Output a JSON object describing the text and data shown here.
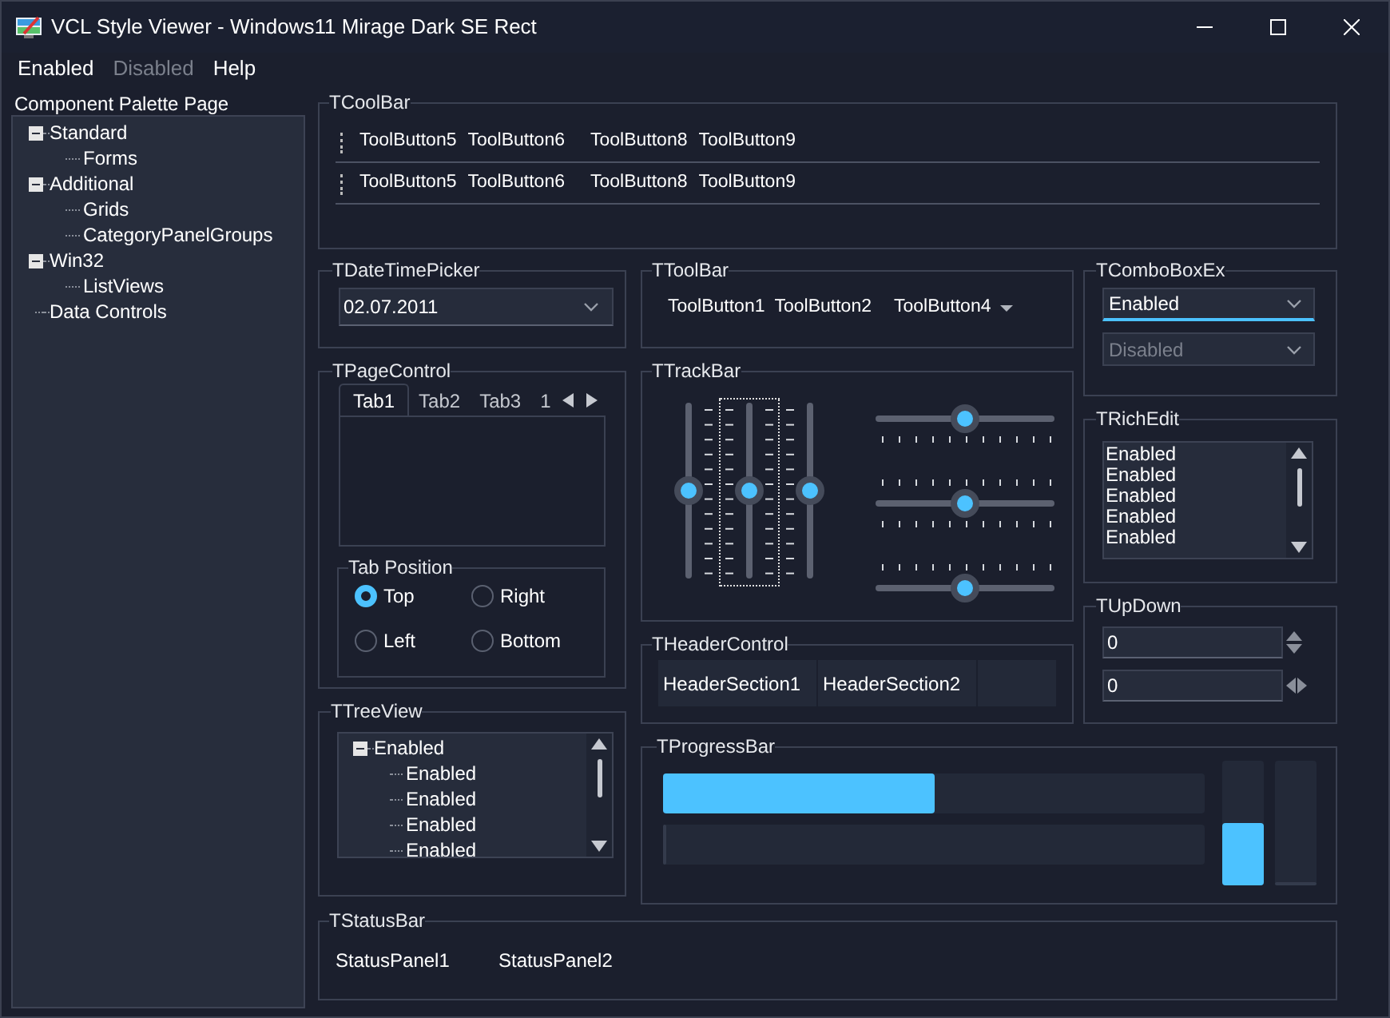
{
  "window": {
    "title": "VCL Style Viewer - Windows11 Mirage Dark SE Rect"
  },
  "menu": [
    {
      "label": "Enabled",
      "disabled": false
    },
    {
      "label": "Disabled",
      "disabled": true
    },
    {
      "label": "Help",
      "disabled": false
    }
  ],
  "palette": {
    "label": "Component Palette Page",
    "tree": [
      {
        "label": "Standard",
        "expanded": true,
        "children": [
          {
            "label": "Forms"
          }
        ]
      },
      {
        "label": "Additional",
        "expanded": true,
        "children": [
          {
            "label": "Grids"
          },
          {
            "label": "CategoryPanelGroups"
          }
        ]
      },
      {
        "label": "Win32",
        "expanded": true,
        "children": [
          {
            "label": "ListViews"
          }
        ]
      },
      {
        "label": "Data Controls"
      }
    ]
  },
  "cool_bar": {
    "title": "TCoolBar",
    "bands": [
      {
        "buttons": [
          "ToolButton5",
          "ToolButton6",
          "ToolButton8",
          "ToolButton9"
        ]
      },
      {
        "buttons": [
          "ToolButton5",
          "ToolButton6",
          "ToolButton8",
          "ToolButton9"
        ]
      }
    ]
  },
  "date_time_picker": {
    "title": "TDateTimePicker",
    "value": "02.07.2011"
  },
  "tool_bar": {
    "title": "TToolBar",
    "buttons": [
      {
        "label": "ToolButton1",
        "dropdown": false
      },
      {
        "label": "ToolButton2",
        "dropdown": false
      },
      {
        "label": "ToolButton4",
        "dropdown": true
      }
    ]
  },
  "combo_box_ex": {
    "title": "TComboBoxEx",
    "boxes": [
      {
        "value": "Enabled",
        "disabled": false,
        "focused": true
      },
      {
        "value": "Disabled",
        "disabled": true,
        "focused": false
      }
    ]
  },
  "page_control": {
    "title": "TPageControl",
    "tabs": [
      {
        "label": "Tab1",
        "selected": true
      },
      {
        "label": "Tab2",
        "selected": false
      },
      {
        "label": "Tab3",
        "selected": false
      },
      {
        "label": "1",
        "selected": false
      }
    ],
    "tab_position": {
      "title": "Tab Position",
      "options": [
        {
          "label": "Top",
          "selected": true
        },
        {
          "label": "Right",
          "selected": false
        },
        {
          "label": "Left",
          "selected": false
        },
        {
          "label": "Bottom",
          "selected": false
        }
      ]
    }
  },
  "track_bar": {
    "title": "TTrackBar",
    "sliders": [
      {
        "kind": "vertical",
        "ticks_before": false,
        "ticks_after": true,
        "focused": false,
        "level": 0.5
      },
      {
        "kind": "vertical",
        "ticks_before": true,
        "ticks_after": true,
        "focused": true,
        "level": 0.5
      },
      {
        "kind": "vertical",
        "ticks_before": true,
        "ticks_after": false,
        "focused": false,
        "level": 0.5
      },
      {
        "kind": "horizontal",
        "ticks_before": false,
        "ticks_after": true,
        "focused": false,
        "level": 0.5
      },
      {
        "kind": "horizontal",
        "ticks_before": true,
        "ticks_after": true,
        "focused": false,
        "level": 0.5
      },
      {
        "kind": "horizontal",
        "ticks_before": true,
        "ticks_after": false,
        "focused": false,
        "level": 0.5
      }
    ]
  },
  "rich_edit": {
    "title": "TRichEdit",
    "lines": [
      "Enabled",
      "Enabled",
      "Enabled",
      "Enabled",
      "Enabled"
    ]
  },
  "up_down": {
    "title": "TUpDown",
    "fields": [
      {
        "kind": "vertical",
        "value": "0"
      },
      {
        "kind": "horizontal",
        "value": "0"
      }
    ]
  },
  "header_control": {
    "title": "THeaderControl",
    "sections": [
      "HeaderSection1",
      "HeaderSection2"
    ]
  },
  "tree_view": {
    "title": "TTreeView",
    "items": [
      {
        "label": "Enabled",
        "expanded": true,
        "children": [
          {
            "label": "Enabled"
          },
          {
            "label": "Enabled"
          },
          {
            "label": "Enabled"
          },
          {
            "label": "Enabled"
          }
        ]
      }
    ]
  },
  "progress_bar": {
    "title": "TProgressBar",
    "horizontal_bars": [
      {
        "level": 0.5
      },
      {
        "level": 0
      }
    ],
    "vertical_bars": [
      {
        "level": 0.5
      },
      {
        "level": 0
      }
    ]
  },
  "status_bar": {
    "title": "TStatusBar",
    "panels": [
      "StatusPanel1",
      "StatusPanel2"
    ]
  }
}
